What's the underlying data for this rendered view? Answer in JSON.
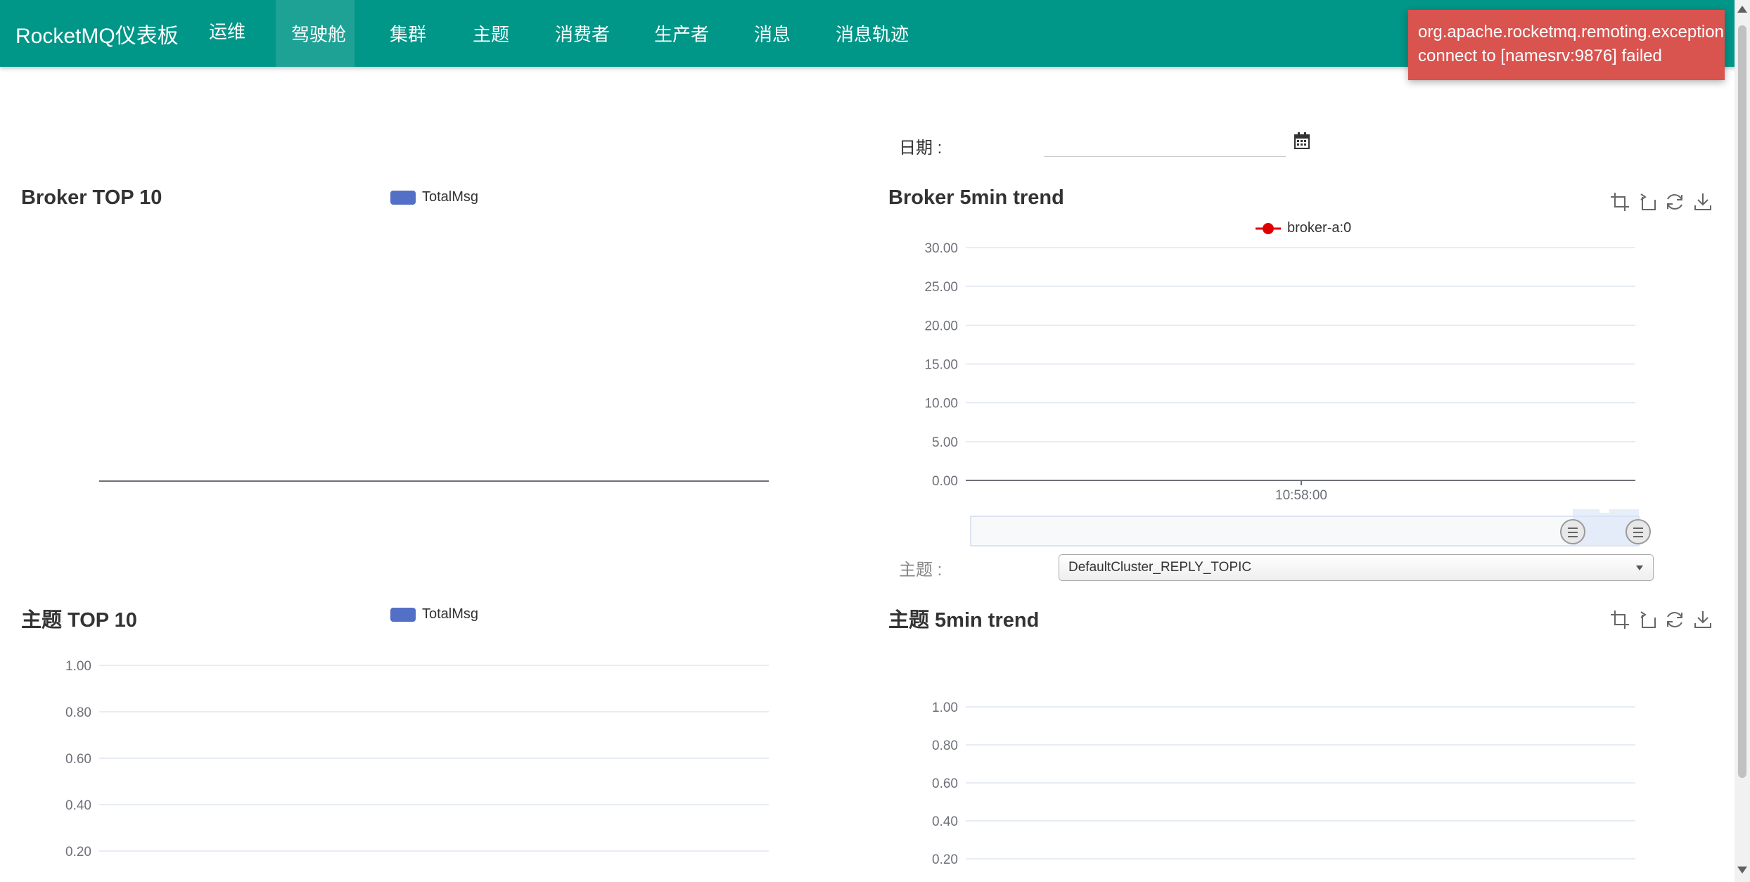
{
  "nav": {
    "brand": "RocketMQ仪表板",
    "items": [
      {
        "label": "运维",
        "active": false
      },
      {
        "label": "驾驶舱",
        "active": true
      },
      {
        "label": "集群",
        "active": false
      },
      {
        "label": "主题",
        "active": false
      },
      {
        "label": "消费者",
        "active": false
      },
      {
        "label": "生产者",
        "active": false
      },
      {
        "label": "消息",
        "active": false
      },
      {
        "label": "消息轨迹",
        "active": false
      }
    ]
  },
  "toast": {
    "line1": "org.apache.rocketmq.remoting.exception.RemotingConnectException:",
    "line2": "connect to [namesrv:9876] failed",
    "color": "#d9534f"
  },
  "filters": {
    "date_label": "日期 :",
    "date_value": "",
    "topic_label": "主题 :",
    "topic_selected": "DefaultCluster_REPLY_TOPIC"
  },
  "toolbox_icons": [
    "zoom-icon",
    "zoom-reset-icon",
    "restore-icon",
    "save-image-icon"
  ],
  "colors": {
    "header": "#009688",
    "bar_series": "#5470c6",
    "line_series": "#e00000"
  },
  "chart_data": [
    {
      "type": "bar",
      "title": "Broker TOP 10",
      "legend": [
        "TotalMsg"
      ],
      "categories": [],
      "series": [
        {
          "name": "TotalMsg",
          "values": []
        }
      ]
    },
    {
      "type": "line",
      "title": "Broker 5min trend",
      "legend": [
        "broker-a:0"
      ],
      "x": [
        "10:58:00"
      ],
      "series": [
        {
          "name": "broker-a:0",
          "values": [
            0
          ]
        }
      ],
      "yticks": [
        "0.00",
        "5.00",
        "10.00",
        "15.00",
        "20.00",
        "25.00",
        "30.00"
      ],
      "ylim": [
        0,
        30
      ],
      "data_zoom": [
        0.9,
        1.0
      ]
    },
    {
      "type": "bar",
      "title": "主题 TOP 10",
      "legend": [
        "TotalMsg"
      ],
      "categories": [],
      "series": [
        {
          "name": "TotalMsg",
          "values": []
        }
      ],
      "yticks": [
        "0.20",
        "0.40",
        "0.60",
        "0.80",
        "1.00"
      ]
    },
    {
      "type": "line",
      "title": "主题 5min trend",
      "legend": [],
      "x": [],
      "series": [],
      "yticks": [
        "0.20",
        "0.40",
        "0.60",
        "0.80",
        "1.00"
      ]
    }
  ]
}
